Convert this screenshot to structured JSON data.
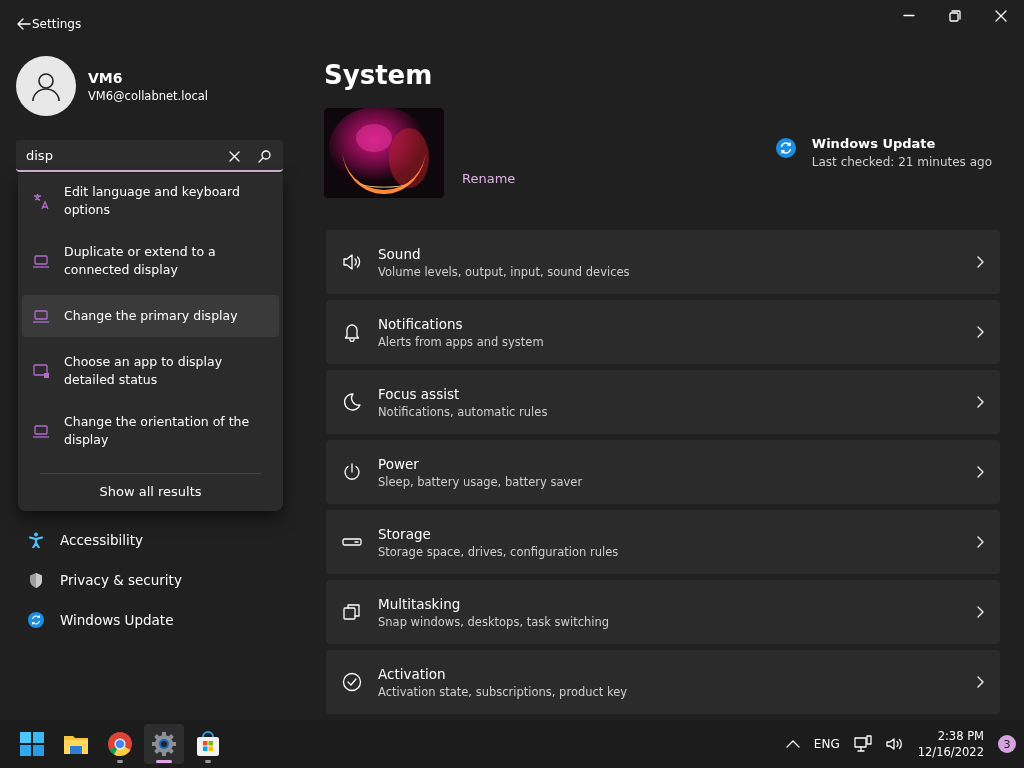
{
  "window": {
    "title": "Settings"
  },
  "user": {
    "name": "VM6",
    "email": "VM6@collabnet.local"
  },
  "search": {
    "value": "disp",
    "results": [
      {
        "label": "Edit language and keyboard options",
        "kind": "language",
        "selected": false
      },
      {
        "label": "Duplicate or extend to a connected display",
        "kind": "display",
        "selected": false
      },
      {
        "label": "Change the primary display",
        "kind": "display",
        "selected": true
      },
      {
        "label": "Choose an app to display detailed status",
        "kind": "status",
        "selected": false
      },
      {
        "label": "Change the orientation of the display",
        "kind": "display",
        "selected": false
      }
    ],
    "show_all": "Show all results"
  },
  "sidebar": {
    "items": [
      {
        "label": "Accessibility",
        "kind": "accessibility"
      },
      {
        "label": "Privacy & security",
        "kind": "privacy"
      },
      {
        "label": "Windows Update",
        "kind": "update"
      }
    ]
  },
  "page": {
    "title": "System",
    "rename": "Rename",
    "update": {
      "title": "Windows Update",
      "subtitle": "Last checked: 21 minutes ago"
    },
    "cards": [
      {
        "title": "Sound",
        "description": "Volume levels, output, input, sound devices",
        "kind": "sound"
      },
      {
        "title": "Notifications",
        "description": "Alerts from apps and system",
        "kind": "notifications"
      },
      {
        "title": "Focus assist",
        "description": "Notifications, automatic rules",
        "kind": "focus"
      },
      {
        "title": "Power",
        "description": "Sleep, battery usage, battery saver",
        "kind": "power"
      },
      {
        "title": "Storage",
        "description": "Storage space, drives, configuration rules",
        "kind": "storage"
      },
      {
        "title": "Multitasking",
        "description": "Snap windows, desktops, task switching",
        "kind": "multitasking"
      },
      {
        "title": "Activation",
        "description": "Activation state, subscriptions, product key",
        "kind": "activation"
      }
    ]
  },
  "taskbar": {
    "apps": [
      {
        "kind": "start",
        "running": false,
        "selected": false
      },
      {
        "kind": "files",
        "running": false,
        "selected": false
      },
      {
        "kind": "browser",
        "running": true,
        "selected": false
      },
      {
        "kind": "settings",
        "running": true,
        "selected": true
      },
      {
        "kind": "store",
        "running": true,
        "selected": false
      }
    ],
    "language": "ENG",
    "time": "2:38 PM",
    "date": "12/16/2022",
    "notifications": "3"
  }
}
